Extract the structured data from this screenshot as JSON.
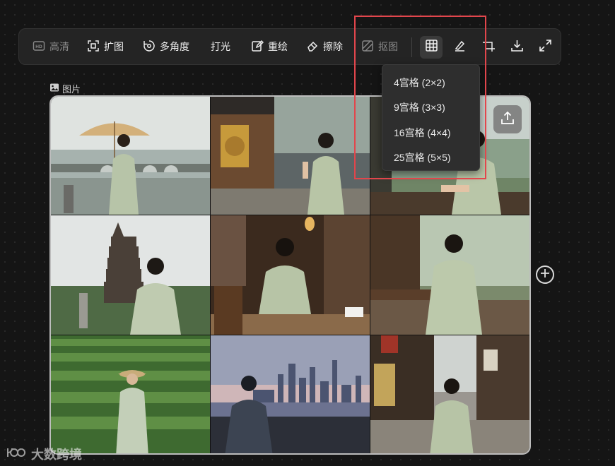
{
  "toolbar": {
    "hd_label": "高清",
    "expand_label": "扩图",
    "multi_angle_label": "多角度",
    "relight_label": "打光",
    "redraw_label": "重绘",
    "erase_label": "擦除",
    "cutout_label": "抠图"
  },
  "grid_menu": {
    "items": [
      "4宫格 (2×2)",
      "9宫格 (3×3)",
      "16宫格 (4×4)",
      "25宫格 (5×5)"
    ]
  },
  "image": {
    "label": "图片",
    "tiles": [
      "woman-with-paper-umbrella-by-stone-bridge",
      "woman-praying-at-temple-incense",
      "woman-leaning-on-railing-by-lake",
      "woman-before-pagoda",
      "woman-drinking-tea-in-teahouse",
      "woman-seated-by-window-willows",
      "woman-with-straw-hat-in-tea-field",
      "woman-silhouette-city-skyline-dusk",
      "woman-in-old-town-street"
    ]
  },
  "watermark": {
    "text": "大数跨境"
  },
  "colors": {
    "highlight": "#e2464c",
    "background": "#151515",
    "toolbar": "#242424"
  },
  "icons": {
    "hd": "hd-icon",
    "expand": "expand-icon",
    "multi_angle": "rotate-icon",
    "redraw": "edit-icon",
    "erase": "eraser-icon",
    "cutout": "cutout-icon",
    "grid": "grid-icon",
    "brush": "brush-icon",
    "crop": "crop-icon",
    "download": "download-icon",
    "fullscreen": "fullscreen-icon",
    "upload": "upload-icon",
    "add": "plus-circle-icon"
  }
}
